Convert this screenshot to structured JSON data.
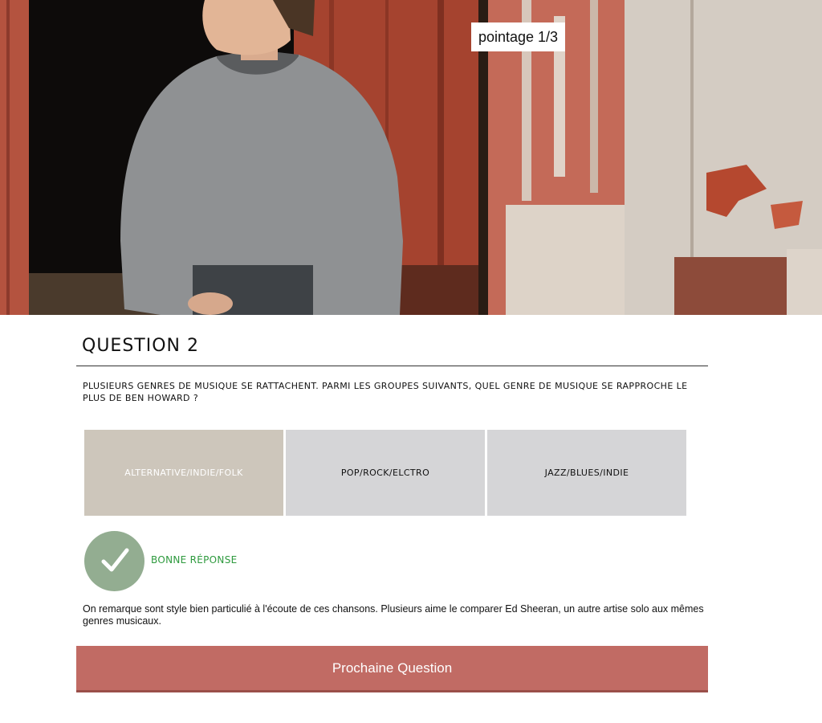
{
  "hero": {
    "score_label": "pointage 1/3"
  },
  "question": {
    "title": "QUESTION 2",
    "text": "PLUSIEURS GENRES DE MUSIQUE SE RATTACHENT. PARMI LES GROUPES SUIVANTS, QUEL GENRE DE MUSIQUE SE RAPPROCHE LE PLUS DE BEN HOWARD ?"
  },
  "answers": [
    {
      "label": "ALTERNATIVE/INDIE/FOLK",
      "selected": true
    },
    {
      "label": "POP/ROCK/ELCTRO",
      "selected": false
    },
    {
      "label": "JAZZ/BLUES/INDIE",
      "selected": false
    }
  ],
  "feedback": {
    "icon": "check-icon",
    "label": "BONNE RÉPONSE",
    "color": "#2e9a3e"
  },
  "explanation": "On remarque sont style bien particulié à l'écoute de ces chansons. Plusieurs aime le comparer Ed Sheeran, un autre artise solo aux mêmes genres musicaux.",
  "next_button": {
    "label": "Prochaine Question",
    "color": "#c16b64"
  }
}
